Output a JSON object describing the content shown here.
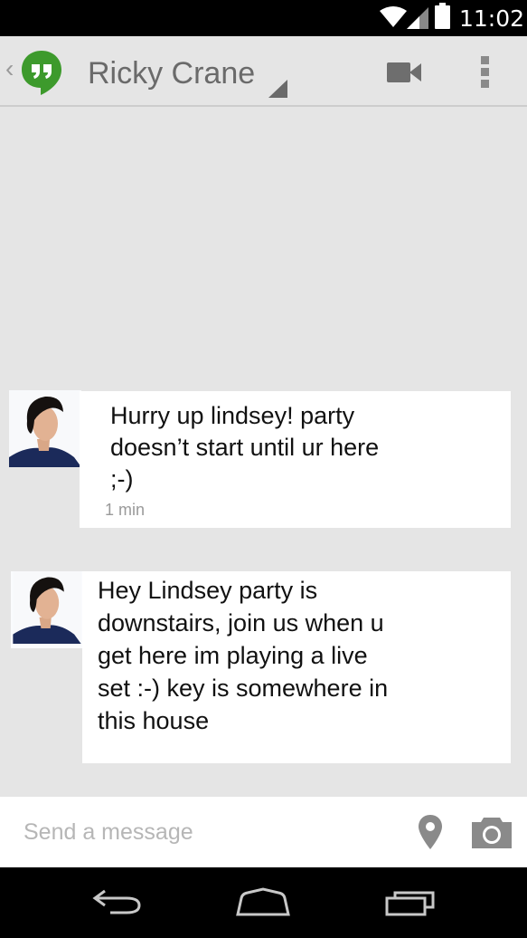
{
  "status_bar": {
    "time": "11:02"
  },
  "action_bar": {
    "contact_name": "Ricky Crane"
  },
  "messages": [
    {
      "lines": [
        "Hurry up lindsey! party",
        "doesn’t start until ur here",
        ";-)"
      ],
      "time": "1 min"
    },
    {
      "lines": [
        "Hey Lindsey party is",
        "downstairs, join us when u",
        "get here im playing a live",
        "set :-) key is somewhere in",
        "this house"
      ]
    }
  ],
  "compose": {
    "placeholder": "Send a message"
  },
  "colors": {
    "hangouts_green": "#3d9a2c",
    "background": "#e5e5e5",
    "bubble": "#ffffff"
  },
  "icons": [
    "wifi-icon",
    "signal-icon",
    "battery-icon",
    "hangouts-logo-icon",
    "video-call-icon",
    "overflow-menu-icon",
    "location-icon",
    "camera-icon",
    "back-icon",
    "home-icon",
    "recent-apps-icon"
  ]
}
